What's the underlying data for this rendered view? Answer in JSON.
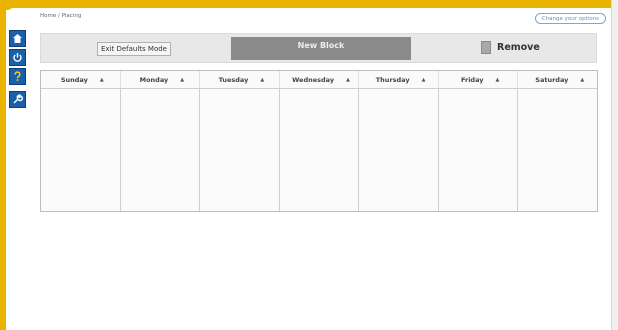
{
  "breadcrumb": "Home / Placing",
  "top_link_label": "Change your options",
  "sidebar": {
    "items": [
      {
        "icon": "home-icon"
      },
      {
        "icon": "power-icon"
      },
      {
        "icon": "help-icon"
      },
      {
        "icon": "wrench-icon"
      }
    ]
  },
  "toolbar": {
    "exit_label": "Exit Defaults Mode",
    "new_block_label": "New Block",
    "remove_label": "Remove"
  },
  "calendar": {
    "days": [
      "Sunday",
      "Monday",
      "Tuesday",
      "Wednesday",
      "Thursday",
      "Friday",
      "Saturday"
    ]
  },
  "colors": {
    "accent": "#e8b400",
    "sidebar_button": "#1a5faa",
    "new_block_bg": "#8a8a8a"
  }
}
